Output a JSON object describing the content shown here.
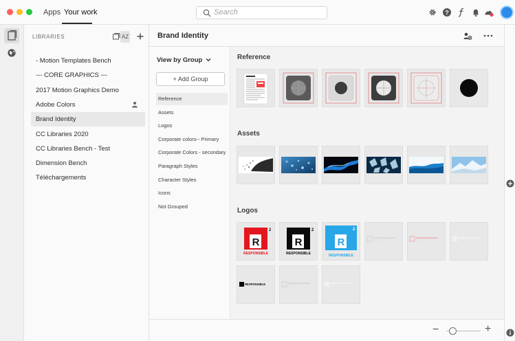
{
  "topbar": {
    "nav_apps": "Apps",
    "nav_work": "Your work",
    "search_placeholder": "Search",
    "icons": [
      "gear-icon",
      "help-icon",
      "fonts-icon",
      "bell-icon",
      "cloud-icon",
      "avatar"
    ]
  },
  "libraries": {
    "title": "LIBRARIES",
    "sort_label": "AZ",
    "items": [
      {
        "label": "- Motion Templates Bench",
        "selected": false,
        "shared": false
      },
      {
        "label": "--- CORE GRAPHICS ---",
        "selected": false,
        "shared": false
      },
      {
        "label": "2017 Motion Graphics Demo",
        "selected": false,
        "shared": false
      },
      {
        "label": "Adobe Colors",
        "selected": false,
        "shared": true
      },
      {
        "label": "Brand Identity",
        "selected": true,
        "shared": false
      },
      {
        "label": "CC Libraries 2020",
        "selected": false,
        "shared": false
      },
      {
        "label": "CC Libraries Bench - Test",
        "selected": false,
        "shared": false
      },
      {
        "label": "Dimension Bench",
        "selected": false,
        "shared": false
      },
      {
        "label": "Téléchargements",
        "selected": false,
        "shared": false
      }
    ]
  },
  "main": {
    "library_name": "Brand Identity",
    "view_by": "View by Group",
    "add_group": "+ Add Group",
    "groups": [
      {
        "label": "Reference",
        "selected": true
      },
      {
        "label": "Assets",
        "selected": false
      },
      {
        "label": "Logos",
        "selected": false
      },
      {
        "label": "Corporate colors-- Primary",
        "selected": false
      },
      {
        "label": "Corporate Colors - secondary",
        "selected": false
      },
      {
        "label": "Paragraph Styles",
        "selected": false
      },
      {
        "label": "Character Styles",
        "selected": false
      },
      {
        "label": "Icons",
        "selected": false
      },
      {
        "label": "Not Grouped",
        "selected": false
      }
    ],
    "sections": {
      "reference": {
        "title": "Reference",
        "tiles": [
          "document-thumbnail",
          "grey-circle-badge",
          "outline-circle-badge",
          "circle-badge-dark",
          "grid-outline",
          "black-circle"
        ]
      },
      "assets": {
        "title": "Assets",
        "tiles": [
          "particle-splash",
          "water-drops",
          "blue-wave",
          "ice-crystals",
          "splash-wave",
          "snow-mountain"
        ]
      },
      "logos": {
        "title": "Logos",
        "tiles": [
          "logo-red",
          "logo-black",
          "logo-blue",
          "logo-placeholder",
          "logo-placeholder-red",
          "logo-placeholder-light",
          "logo-black-horizontal",
          "logo-placeholder-2",
          "logo-placeholder-3"
        ]
      }
    },
    "logo_text": "RESPONSIBLE",
    "logo_letter": "R",
    "logo_superscript": "2"
  },
  "colors": {
    "accent_blue": "#2d8ceb",
    "logo_red": "#e3161f",
    "logo_blue": "#27a6e8"
  }
}
